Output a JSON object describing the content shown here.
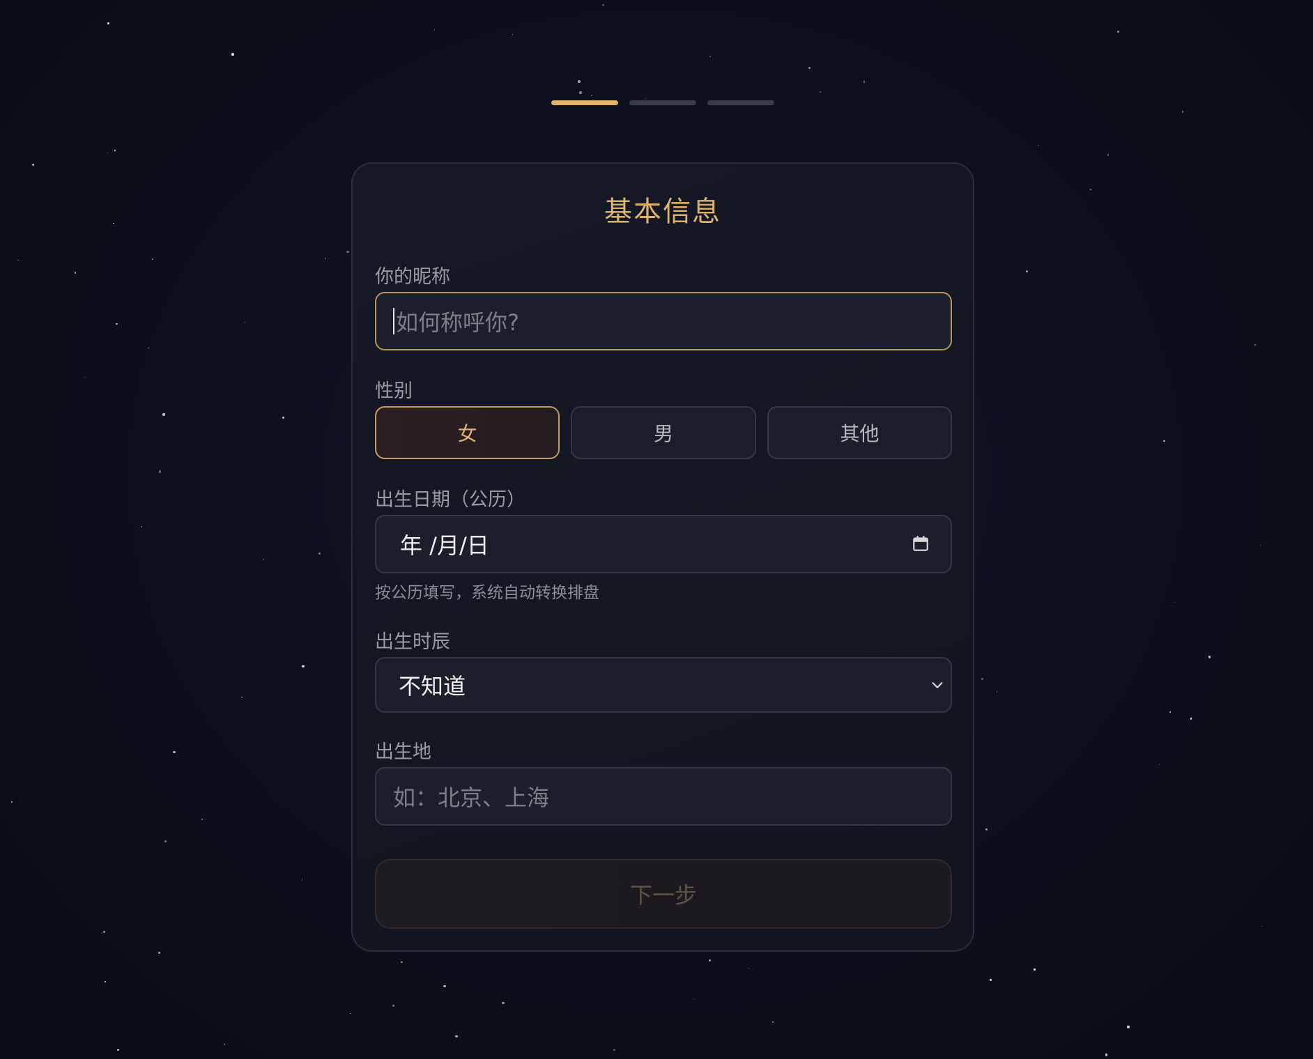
{
  "progress": {
    "steps": 3,
    "current": 1
  },
  "form": {
    "title": "基本信息",
    "nickname": {
      "label": "你的昵称",
      "placeholder": "如何称呼你?"
    },
    "gender": {
      "label": "性别",
      "options": [
        "女",
        "男",
        "其他"
      ],
      "selected": "女"
    },
    "birth_date": {
      "label": "出生日期（公历）",
      "value": "年 /月/日",
      "hint": "按公历填写，系统自动转换排盘"
    },
    "birth_hour": {
      "label": "出生时辰",
      "value": "不知道"
    },
    "birth_place": {
      "label": "出生地",
      "placeholder": "如：北京、上海"
    },
    "next_button": "下一步"
  },
  "colors": {
    "accent": "#dcb46e",
    "background": "#0b0d16",
    "card": "#141622"
  },
  "icons": [
    "calendar-icon",
    "chevron-down-icon"
  ]
}
